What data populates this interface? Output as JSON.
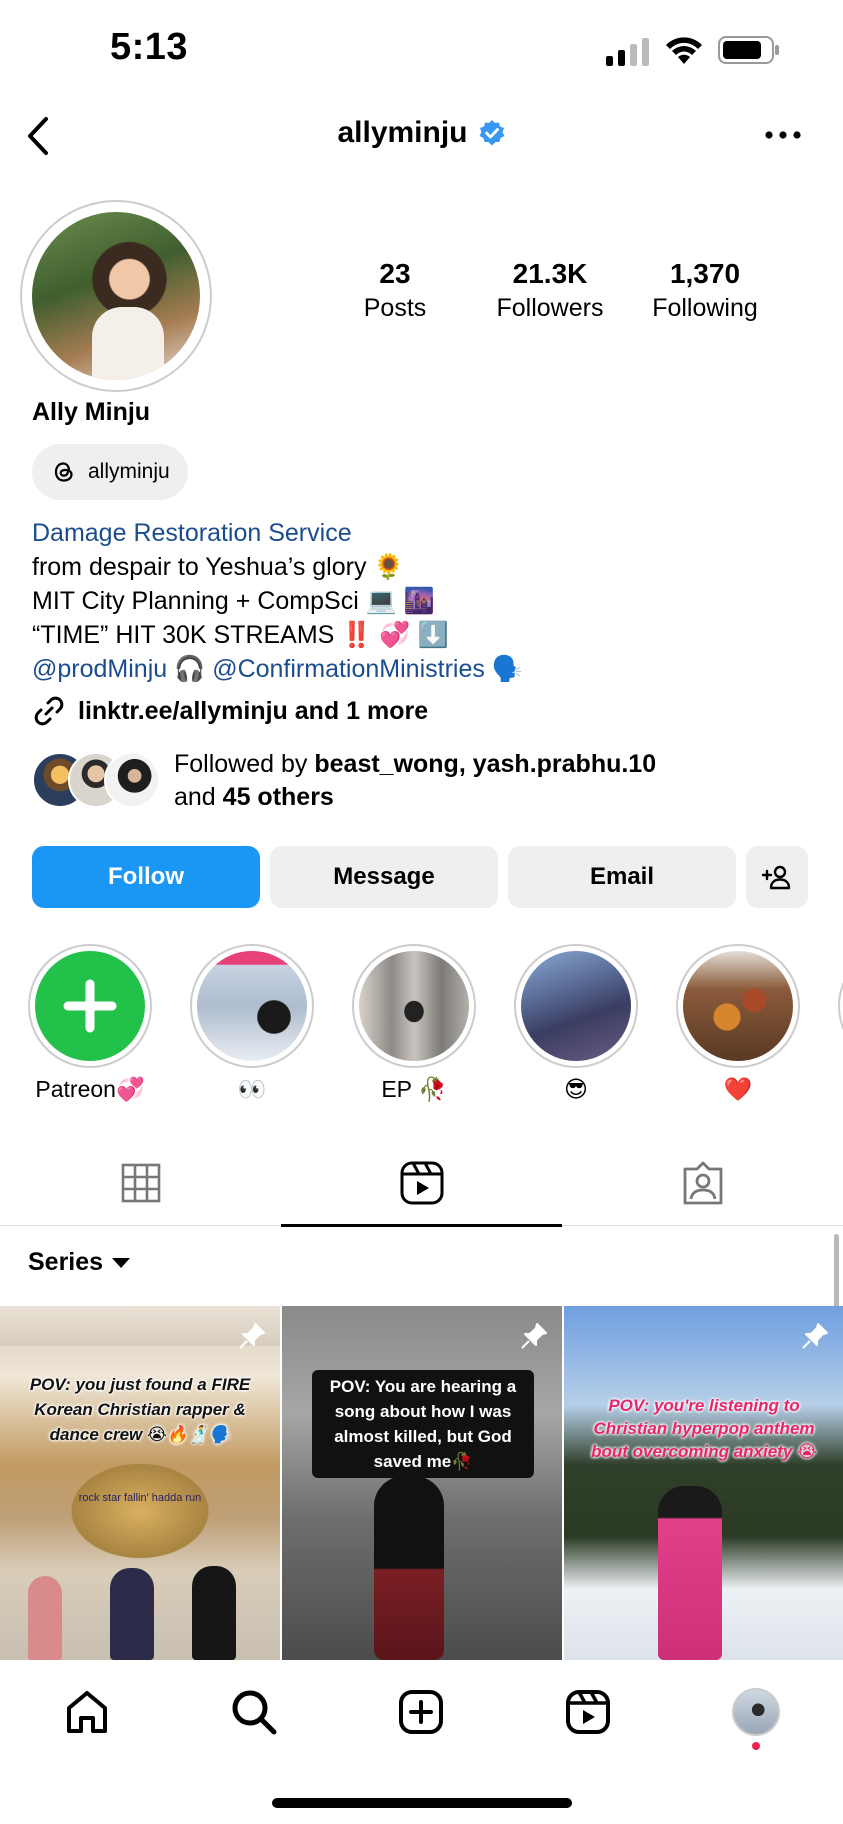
{
  "status_bar": {
    "time": "5:13"
  },
  "header": {
    "username": "allyminju",
    "verified": true
  },
  "profile": {
    "stats": [
      {
        "value": "23",
        "label": "Posts"
      },
      {
        "value": "21.3K",
        "label": "Followers"
      },
      {
        "value": "1,370",
        "label": "Following"
      }
    ],
    "display_name": "Ally Minju",
    "threads_handle": "allyminju",
    "category": "Damage Restoration Service",
    "bio_lines": [
      "from despair to Yeshua’s glory 🌻",
      "MIT City Planning + CompSci 💻 🌆",
      "“TIME” HIT 30K STREAMS ‼️ 💞 ⬇️"
    ],
    "mention_1": "@prodMinju",
    "mention_sep": " 🎧 ",
    "mention_2": "@ConfirmationMinistries",
    "mention_tail": " 🗣️",
    "link_text": "linktr.ee/allyminju and 1 more",
    "followed_by_prefix": "Followed by ",
    "followed_by_names": "beast_wong, yash.prabhu.10",
    "followed_by_and": "and ",
    "followed_by_others": "45 others"
  },
  "buttons": {
    "follow": "Follow",
    "message": "Message",
    "email": "Email"
  },
  "highlights": [
    {
      "label": "Patreon💞"
    },
    {
      "label": "👀"
    },
    {
      "label": "EP 🥀"
    },
    {
      "label": "😎"
    },
    {
      "label": "❤️"
    }
  ],
  "series_label": "Series",
  "reels": [
    {
      "caption": "POV: you just found a FIRE Korean Christian rapper & dance crew 😭🔥🕺🗣️",
      "subcaption": "rock star fallin' hadda run"
    },
    {
      "caption": "POV: You are hearing a song about how I was almost killed, but God saved me🥀"
    },
    {
      "caption": "POV: you're listening to Christian hyperpop anthem bout overcoming anxiety 😭"
    }
  ],
  "colors": {
    "follow_blue": "#1a97f5",
    "link_blue": "#1b4d8e",
    "verified_blue": "#3897f0",
    "patreon_green": "#22c24a"
  }
}
